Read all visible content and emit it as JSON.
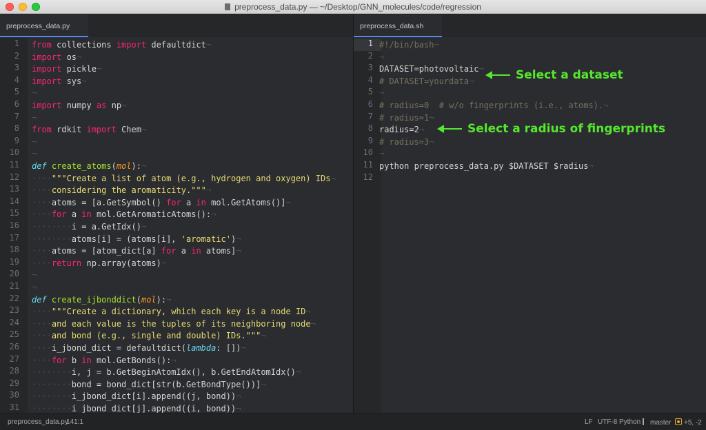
{
  "window": {
    "title": "preprocess_data.py — ~/Desktop/GNN_molecules/code/regression"
  },
  "left_pane": {
    "tab_label": "preprocess_data.py",
    "line_numbers": [
      "1",
      "2",
      "3",
      "4",
      "5",
      "6",
      "7",
      "8",
      "9",
      "10",
      "11",
      "12",
      "13",
      "14",
      "15",
      "16",
      "17",
      "18",
      "19",
      "20",
      "21",
      "22",
      "23",
      "24",
      "25",
      "26",
      "27",
      "28",
      "29",
      "30",
      "31"
    ],
    "lines": [
      "from collections import defaultdict",
      "import os",
      "import pickle",
      "import sys",
      "",
      "import numpy as np",
      "",
      "from rdkit import Chem",
      "",
      "",
      "def create_atoms(mol):",
      "    \"\"\"Create a list of atom (e.g., hydrogen and oxygen) IDs",
      "    considering the aromaticity.\"\"\"",
      "    atoms = [a.GetSymbol() for a in mol.GetAtoms()]",
      "    for a in mol.GetAromaticAtoms():",
      "        i = a.GetIdx()",
      "        atoms[i] = (atoms[i], 'aromatic')",
      "    atoms = [atom_dict[a] for a in atoms]",
      "    return np.array(atoms)",
      "",
      "",
      "def create_ijbonddict(mol):",
      "    \"\"\"Create a dictionary, which each key is a node ID",
      "    and each value is the tuples of its neighboring node",
      "    and bond (e.g., single and double) IDs.\"\"\"",
      "    i_jbond_dict = defaultdict(lambda: [])",
      "    for b in mol.GetBonds():",
      "        i, j = b.GetBeginAtomIdx(), b.GetEndAtomIdx()",
      "        bond = bond_dict[str(b.GetBondType())]",
      "        i_jbond_dict[i].append((j, bond))",
      "        i_jbond_dict[j].append((i, bond))"
    ]
  },
  "right_pane": {
    "tab_label": "preprocess_data.sh",
    "line_numbers": [
      "1",
      "2",
      "3",
      "4",
      "5",
      "6",
      "7",
      "8",
      "9",
      "10",
      "11",
      "12"
    ],
    "lines": [
      "#!/bin/bash",
      "",
      "DATASET=photovoltaic",
      "# DATASET=yourdata",
      "",
      "# radius=0  # w/o fingerprints (i.e., atoms).",
      "# radius=1",
      "radius=2",
      "# radius=3",
      "",
      "python preprocess_data.py $DATASET $radius",
      ""
    ]
  },
  "annotations": {
    "dataset": "Select a dataset",
    "radius": "Select a radius of fingerprints"
  },
  "statusbar": {
    "file": "preprocess_data.py",
    "position": "141:1",
    "line_ending": "LF",
    "encoding": "UTF-8",
    "grammar": "Python",
    "branch": "master",
    "git_changes": "+5, -2"
  },
  "colors": {
    "keyword": "#f92672",
    "function": "#a6e22e",
    "string": "#e6db74",
    "comment": "#75715e",
    "annotation": "#55e62f"
  }
}
